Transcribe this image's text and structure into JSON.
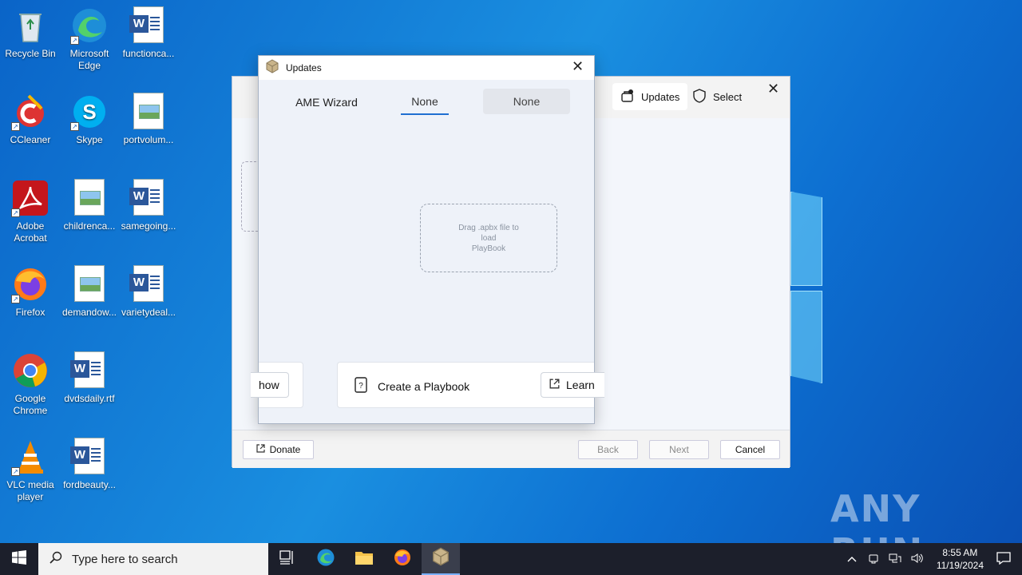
{
  "desktop": {
    "icons": [
      {
        "label": "Recycle Bin"
      },
      {
        "label": "Microsoft Edge"
      },
      {
        "label": "functionca..."
      },
      {
        "label": "CCleaner"
      },
      {
        "label": "Skype"
      },
      {
        "label": "portvolum..."
      },
      {
        "label": "Adobe Acrobat"
      },
      {
        "label": "childrenca..."
      },
      {
        "label": "samegoing..."
      },
      {
        "label": "Firefox"
      },
      {
        "label": "demandow..."
      },
      {
        "label": "varietydeal..."
      },
      {
        "label": "Google Chrome"
      },
      {
        "label": "dvdsdaily.rtf"
      },
      {
        "label": "VLC media player"
      },
      {
        "label": "fordbeauty..."
      }
    ],
    "watermark": "ANY RUN"
  },
  "main_window": {
    "toolbar": {
      "updates_label": "Updates",
      "select_label": "Select"
    },
    "footer": {
      "donate_label": "Donate",
      "back_label": "Back",
      "next_label": "Next",
      "cancel_label": "Cancel"
    }
  },
  "updates_dialog": {
    "title": "Updates",
    "tabs": [
      {
        "label": "AME Wizard"
      },
      {
        "label": "None"
      },
      {
        "label": "None"
      }
    ],
    "dropzone": {
      "line1": "Drag .apbx file to",
      "line2": "load",
      "line3": "PlayBook"
    },
    "cards": {
      "show_label": "how",
      "create_label": "Create a Playbook",
      "learn_label": "Learn"
    }
  },
  "taskbar": {
    "search_placeholder": "Type here to search",
    "time": "8:55 AM",
    "date": "11/19/2024"
  },
  "colors": {
    "accent": "#1f6fd1",
    "desktop": "#1a8fe0",
    "taskbar": "#1c1f2b"
  }
}
